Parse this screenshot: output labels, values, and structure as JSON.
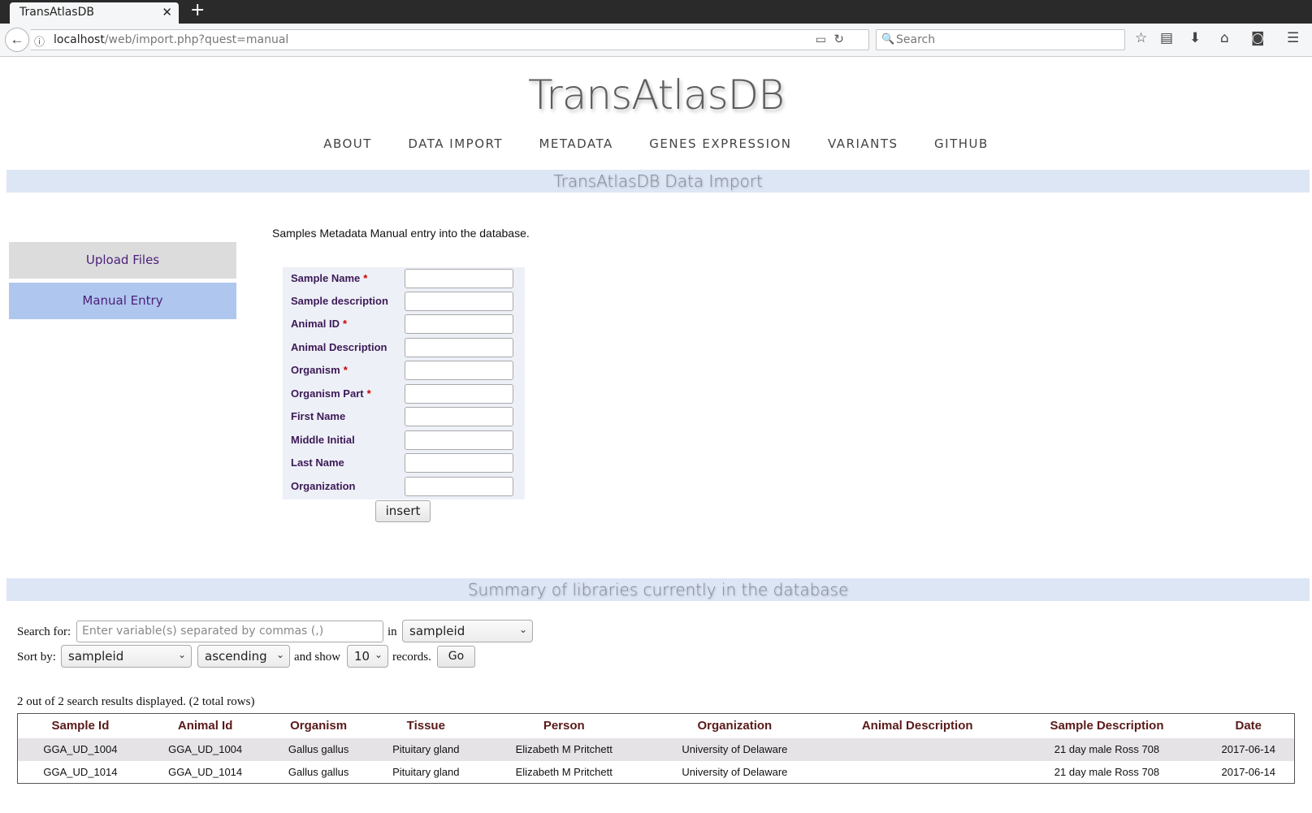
{
  "browser": {
    "tab_title": "TransAtlasDB",
    "url_host": "localhost",
    "url_path": "/web/import.php?quest=manual",
    "search_placeholder": "Search"
  },
  "site": {
    "logo": "TransAtlasDB",
    "nav": [
      "ABOUT",
      "DATA IMPORT",
      "METADATA",
      "GENES EXPRESSION",
      "VARIANTS",
      "GITHUB"
    ]
  },
  "import_section": {
    "banner": "TransAtlasDB Data Import",
    "sidebar": {
      "upload": "Upload Files",
      "manual": "Manual Entry",
      "active": "Manual Entry"
    },
    "intro": "Samples Metadata Manual entry into the database.",
    "fields": [
      {
        "label": "Sample Name",
        "required": "*"
      },
      {
        "label": "Sample description",
        "required": ""
      },
      {
        "label": "Animal ID",
        "required": "*"
      },
      {
        "label": "Animal Description",
        "required": ""
      },
      {
        "label": "Organism",
        "required": "*"
      },
      {
        "label": "Organism Part",
        "required": "*"
      },
      {
        "label": "First Name",
        "required": ""
      },
      {
        "label": "Middle Initial",
        "required": ""
      },
      {
        "label": "Last Name",
        "required": ""
      },
      {
        "label": "Organization",
        "required": ""
      }
    ],
    "insert_label": "insert"
  },
  "summary_section": {
    "banner": "Summary of libraries currently in the database",
    "search_label": "Search for:",
    "search_placeholder": "Enter variable(s) separated by commas (,)",
    "in_label": "in",
    "search_field": "sampleid",
    "sort_label": "Sort by:",
    "sort_field": "sampleid",
    "sort_order": "ascending",
    "show_label": "and show",
    "show_count": "10",
    "records_label": "records.",
    "go_label": "Go",
    "results_text": "2 out of 2 search results displayed. (2 total rows)",
    "columns": [
      "Sample Id",
      "Animal Id",
      "Organism",
      "Tissue",
      "Person",
      "Organization",
      "Animal Description",
      "Sample Description",
      "Date"
    ],
    "rows": [
      [
        "GGA_UD_1004",
        "GGA_UD_1004",
        "Gallus gallus",
        "Pituitary gland",
        "Elizabeth M Pritchett",
        "University of Delaware",
        "",
        "21 day male Ross 708",
        "2017-06-14"
      ],
      [
        "GGA_UD_1014",
        "GGA_UD_1014",
        "Gallus gallus",
        "Pituitary gland",
        "Elizabeth M Pritchett",
        "University of Delaware",
        "",
        "21 day male Ross 708",
        "2017-06-14"
      ]
    ]
  }
}
